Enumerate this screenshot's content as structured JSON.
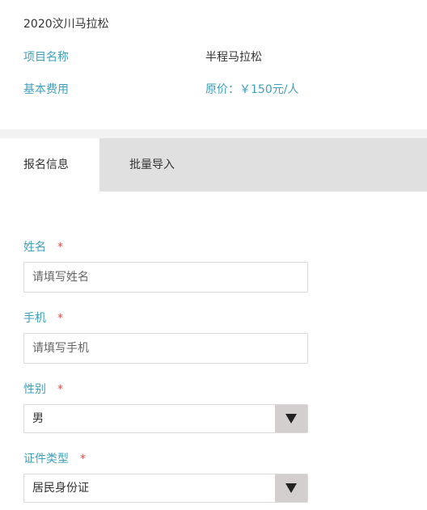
{
  "event": {
    "title": "2020汶川马拉松",
    "project_label": "项目名称",
    "project_value": "半程马拉松",
    "fee_label": "基本费用",
    "fee_value": "原价：￥150元/人"
  },
  "tabs": [
    {
      "label": "报名信息",
      "active": true
    },
    {
      "label": "批量导入",
      "active": false
    }
  ],
  "form": {
    "required_mark": "*",
    "name": {
      "label": "姓名",
      "placeholder": "请填写姓名",
      "value": ""
    },
    "phone": {
      "label": "手机",
      "placeholder": "请填写手机",
      "value": ""
    },
    "gender": {
      "label": "性别",
      "value": "男"
    },
    "id_type": {
      "label": "证件类型",
      "value": "居民身份证"
    }
  },
  "colors": {
    "accent": "#3fa0bb",
    "required": "#d9534f",
    "tab_bar": "#e0e0e0",
    "select_arrow_bg": "#d3cfcf"
  },
  "icons": {
    "dropdown": "triangle-down-icon"
  }
}
